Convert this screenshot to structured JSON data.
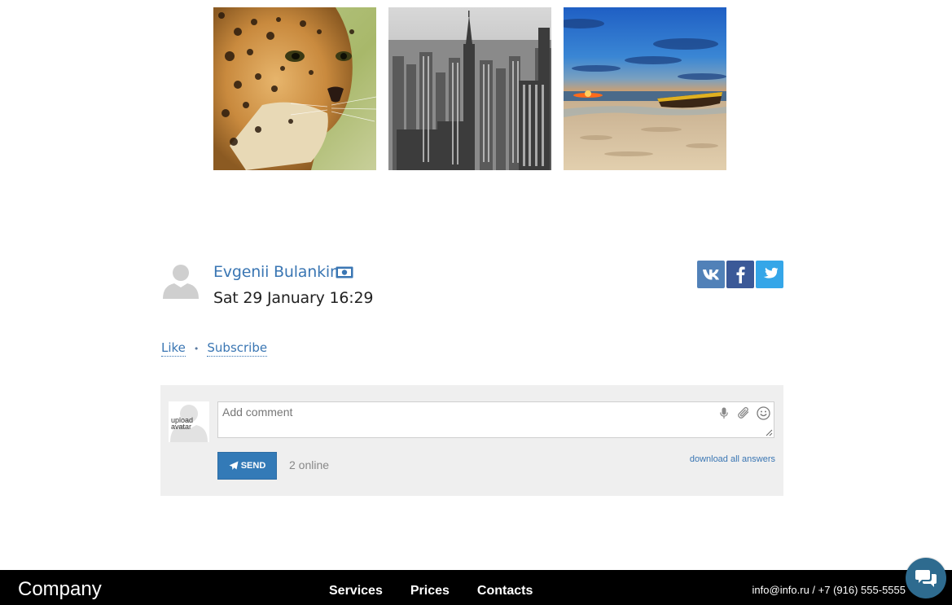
{
  "gallery": {
    "images": [
      {
        "subject": "leopard"
      },
      {
        "subject": "city-skyline"
      },
      {
        "subject": "beach-sunset-boat"
      }
    ]
  },
  "post": {
    "author_name": "Evgenii Bulankin",
    "date": "Sat 29 January 16:29"
  },
  "share": {
    "buttons": [
      {
        "network": "vk",
        "icon": "vk-icon",
        "color": "#5181b8"
      },
      {
        "network": "facebook",
        "icon": "facebook-icon",
        "color": "#3b5998"
      },
      {
        "network": "twitter",
        "icon": "twitter-icon",
        "color": "#35a6e8"
      }
    ]
  },
  "actions": {
    "like_label": "Like",
    "separator": "•",
    "subscribe_label": "Subscribe"
  },
  "comment": {
    "avatar_text_line1": "upload",
    "avatar_text_line2": "avatar",
    "placeholder": "Add comment",
    "send_label": "SEND",
    "online_text": "2 online",
    "download_label": "download all answers"
  },
  "footer": {
    "brand": "Company",
    "nav": [
      "Services",
      "Prices",
      "Contacts"
    ],
    "contact": "info@info.ru / +7 (916) 555-5555"
  },
  "colors": {
    "accent": "#337ab7",
    "link": "#3a76b3",
    "footer_bg": "#000000",
    "chat_button": "#2e6b8f"
  }
}
